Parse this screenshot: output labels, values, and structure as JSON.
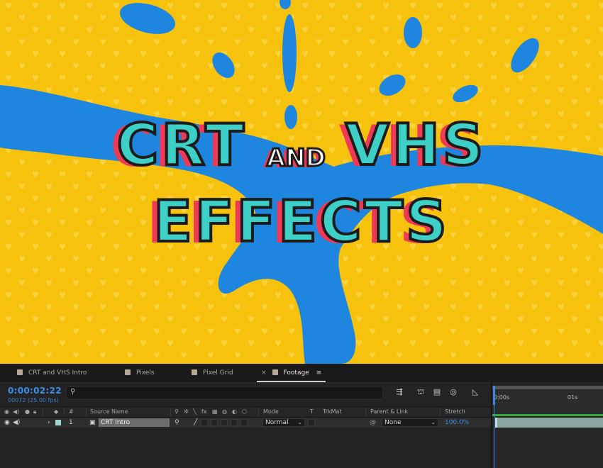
{
  "viewer": {
    "title_line1_left": "CRT",
    "title_line1_mid": "AND",
    "title_line1_right": "VHS",
    "title_line2": "EFFECTS",
    "colors": {
      "background": "#f6c20e",
      "splash": "#1f86df",
      "letter_fill": "#3ecfc6",
      "shadow": "#ef3a57"
    }
  },
  "tabs": [
    {
      "label": "CRT and VHS Intro",
      "active": false
    },
    {
      "label": "Pixels",
      "active": false
    },
    {
      "label": "Pixel Grid",
      "active": false
    },
    {
      "label": "Footage",
      "active": true
    }
  ],
  "timecode": "0:00:02:22",
  "frames": "00072 (25.00 fps)",
  "search": {
    "placeholder": ""
  },
  "columns": {
    "number": "#",
    "source_name": "Source Name",
    "switches": "fx",
    "mode": "Mode",
    "t": "T",
    "trkmat": "TrkMat",
    "parent": "Parent & Link",
    "stretch": "Stretch"
  },
  "layer": {
    "index": "1",
    "name": "CRT Intro",
    "mode": "Normal",
    "parent": "None",
    "stretch": "100.0%",
    "label_color": "#9fd6ce"
  },
  "ruler": {
    "start": "0:00s",
    "mark": "01s"
  }
}
